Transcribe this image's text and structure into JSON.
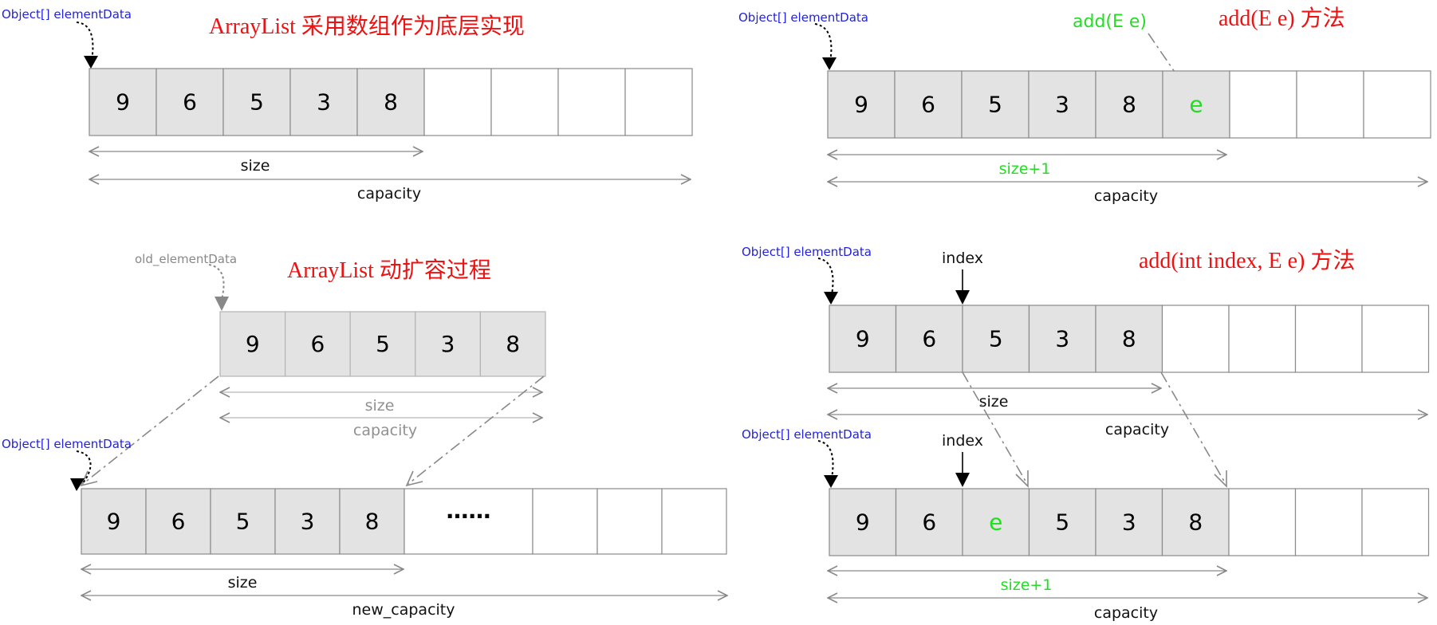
{
  "panel_top_left": {
    "title": "ArrayList 采用数组作为底层实现",
    "pointer_label": "Object[] elementData",
    "cells": [
      "9",
      "6",
      "5",
      "3",
      "8",
      "",
      "",
      "",
      ""
    ],
    "size_label": "size",
    "capacity_label": "capacity"
  },
  "panel_top_right": {
    "title": "add(E e)  方法",
    "pointer_label": "Object[] elementData",
    "call_label": "add(E e)",
    "cells": [
      "9",
      "6",
      "5",
      "3",
      "8",
      "e",
      "",
      "",
      ""
    ],
    "size_label": "size+1",
    "capacity_label": "capacity"
  },
  "panel_bottom_left": {
    "title": "ArrayList 动扩容过程",
    "old_pointer_label": "old_elementData",
    "old_cells": [
      "9",
      "6",
      "5",
      "3",
      "8"
    ],
    "old_size_label": "size",
    "old_capacity_label": "capacity",
    "new_pointer_label": "Object[] elementData",
    "new_cells": [
      "9",
      "6",
      "5",
      "3",
      "8",
      "……",
      "",
      "",
      ""
    ],
    "size_label": "size",
    "capacity_label": "new_capacity"
  },
  "panel_bottom_right": {
    "title": "add(int index, E e)  方法",
    "before_pointer_label": "Object[] elementData",
    "before_index_label": "index",
    "before_cells": [
      "9",
      "6",
      "5",
      "3",
      "8",
      "",
      "",
      "",
      ""
    ],
    "before_size_label": "size",
    "before_capacity_label": "capacity",
    "after_pointer_label": "Object[] elementData",
    "after_index_label": "index",
    "after_cells": [
      "9",
      "6",
      "e",
      "5",
      "3",
      "8",
      "",
      "",
      ""
    ],
    "after_size_label": "size+1",
    "after_capacity_label": "capacity"
  },
  "colors": {
    "filled_cell": "#e3e3e3",
    "cell_border": "#8a8a8a",
    "highlight_green": "#22dd22",
    "title_red": "#ee1111",
    "pointer_blue": "#2222dd"
  }
}
